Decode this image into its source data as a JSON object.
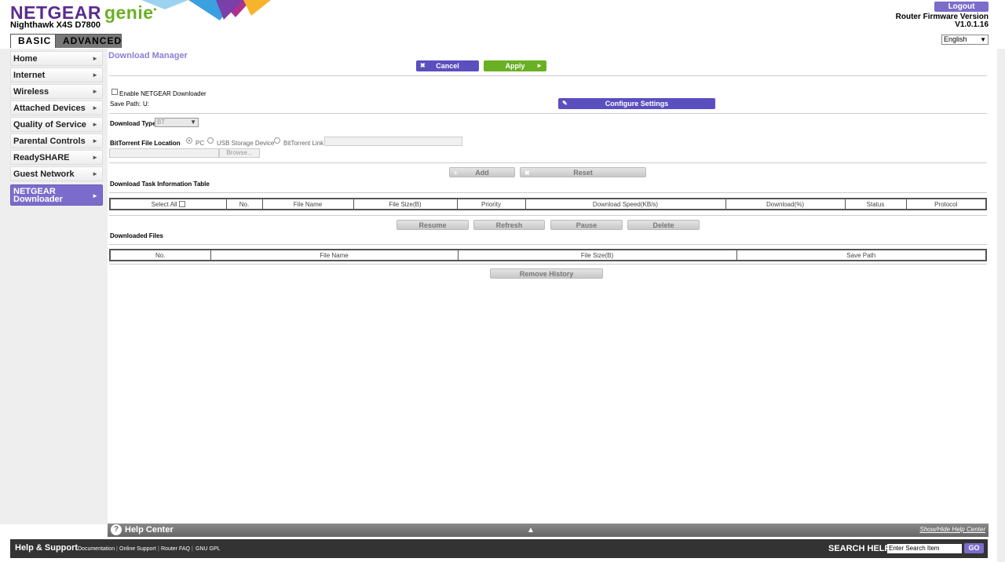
{
  "header": {
    "brand": "NETGEAR",
    "genie": "genie",
    "model": "Nighthawk X4S D7800",
    "tabs": [
      "BASIC",
      "ADVANCED"
    ],
    "logout_label": "Logout",
    "firmware_label": "Router Firmware Version",
    "firmware_version": "V1.0.1.16",
    "language": "English"
  },
  "sidebar": {
    "items": [
      {
        "label": "Home"
      },
      {
        "label": "Internet"
      },
      {
        "label": "Wireless"
      },
      {
        "label": "Attached Devices"
      },
      {
        "label": "Quality of Service"
      },
      {
        "label": "Parental Controls"
      },
      {
        "label": "ReadySHARE"
      },
      {
        "label": "Guest Network"
      },
      {
        "label_line1": "NETGEAR",
        "label_line2": "Downloader"
      }
    ]
  },
  "main": {
    "title": "Download Manager",
    "cancel_label": "Cancel",
    "apply_label": "Apply",
    "enable_label": "Enable NETGEAR Downloader",
    "save_path_label": "Save Path:",
    "save_path_value": "U:",
    "configure_label": "Configure Settings",
    "download_type_label": "Download Type",
    "download_type_value": "BT",
    "bt_location_label": "BitTorrent File Location",
    "radio_pc": "PC",
    "radio_usb": "USB Storage Device",
    "radio_link": "BitTorrent Link",
    "browse_label": "Browse...",
    "add_label": "Add",
    "reset_label": "Reset",
    "task_table_title": "Download Task Information Table",
    "task_columns": {
      "select_all": "Select All",
      "no": "No.",
      "file_name": "File Name",
      "file_size": "File Size(B)",
      "priority": "Priority",
      "speed": "Download Speed(KB/s)",
      "download_pct": "Download(%)",
      "status": "Status",
      "protocol": "Protocol"
    },
    "resume_label": "Resume",
    "refresh_label": "Refresh",
    "pause_label": "Pause",
    "delete_label": "Delete",
    "downloaded_title": "Downloaded Files",
    "downloaded_columns": {
      "no": "No.",
      "file_name": "File Name",
      "file_size": "File Size(B)",
      "save_path": "Save Path"
    },
    "remove_history_label": "Remove History"
  },
  "help": {
    "title": "Help Center",
    "toggle_link": "Show/Hide Help Center"
  },
  "footer": {
    "title": "Help & Support",
    "links": [
      "Documentation",
      "Online Support",
      "Router FAQ",
      "GNU GPL"
    ],
    "search_label": "SEARCH HELP",
    "search_placeholder": "Enter Search Item",
    "go_label": "GO"
  },
  "colors": {
    "purple": "#5b4fbf",
    "green": "#6ab023",
    "divider": "#7b6ccc"
  }
}
